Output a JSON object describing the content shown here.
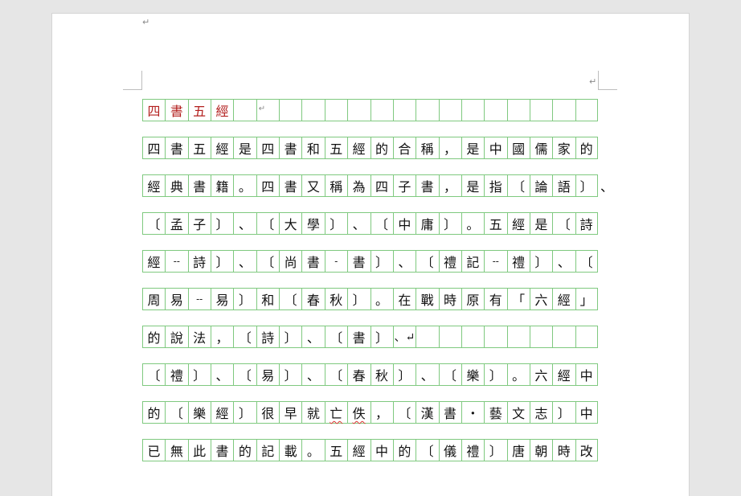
{
  "document": {
    "header_mark": "↵",
    "top_mark": "↵",
    "rows": [
      [
        "四",
        "書",
        "五",
        "經",
        "",
        "↵",
        "",
        "",
        "",
        "",
        "",
        "",
        "",
        "",
        "",
        "",
        "",
        "",
        "",
        ""
      ],
      [
        "四",
        "書",
        "五",
        "經",
        "是",
        "四",
        "書",
        "和",
        "五",
        "經",
        "的",
        "合",
        "稱",
        "，",
        "是",
        "中",
        "國",
        "儒",
        "家",
        "的"
      ],
      [
        "經",
        "典",
        "書",
        "籍",
        "。",
        "四",
        "書",
        "又",
        "稱",
        "為",
        "四",
        "子",
        "書",
        "，",
        "是",
        "指",
        "〔",
        "論",
        "語",
        "〕"
      ],
      [
        "〔",
        "孟",
        "子",
        "〕",
        "、",
        "〔",
        "大",
        "學",
        "〕",
        "、",
        "〔",
        "中",
        "庸",
        "〕",
        "。",
        "五",
        "經",
        "是",
        "〔",
        "詩"
      ],
      [
        "經",
        "--",
        "詩",
        "〕",
        "、",
        "〔",
        "尚",
        "書",
        "-",
        "書",
        "〕",
        "、",
        "〔",
        "禮",
        "記",
        "--",
        "禮",
        "〕",
        "、",
        "〔"
      ],
      [
        "周",
        "易",
        "--",
        "易",
        "〕",
        "和",
        "〔",
        "春",
        "秋",
        "〕",
        "。",
        "在",
        "戰",
        "時",
        "原",
        "有",
        "「",
        "六",
        "經",
        "」"
      ],
      [
        "的",
        "說",
        "法",
        "，",
        "〔",
        "詩",
        "〕",
        "、",
        "〔",
        "書",
        "〕",
        "、↵",
        "",
        "",
        "",
        "",
        "",
        "",
        "",
        ""
      ],
      [
        "〔",
        "禮",
        "〕",
        "、",
        "〔",
        "易",
        "〕",
        "、",
        "〔",
        "春",
        "秋",
        "〕",
        "、",
        "〔",
        "樂",
        "〕",
        "。",
        "六",
        "經",
        "中"
      ],
      [
        "的",
        "〔",
        "樂",
        "經",
        "〕",
        "很",
        "早",
        "就",
        "亡",
        "佚",
        "，",
        "〔",
        "漢",
        "書",
        "・",
        "藝",
        "文",
        "志",
        "〕",
        "中"
      ],
      [
        "已",
        "無",
        "此",
        "書",
        "的",
        "記",
        "載",
        "。",
        "五",
        "經",
        "中",
        "的",
        "〔",
        "儀",
        "禮",
        "〕",
        "唐",
        "朝",
        "時",
        "改"
      ]
    ],
    "row2_overflow": "、"
  }
}
